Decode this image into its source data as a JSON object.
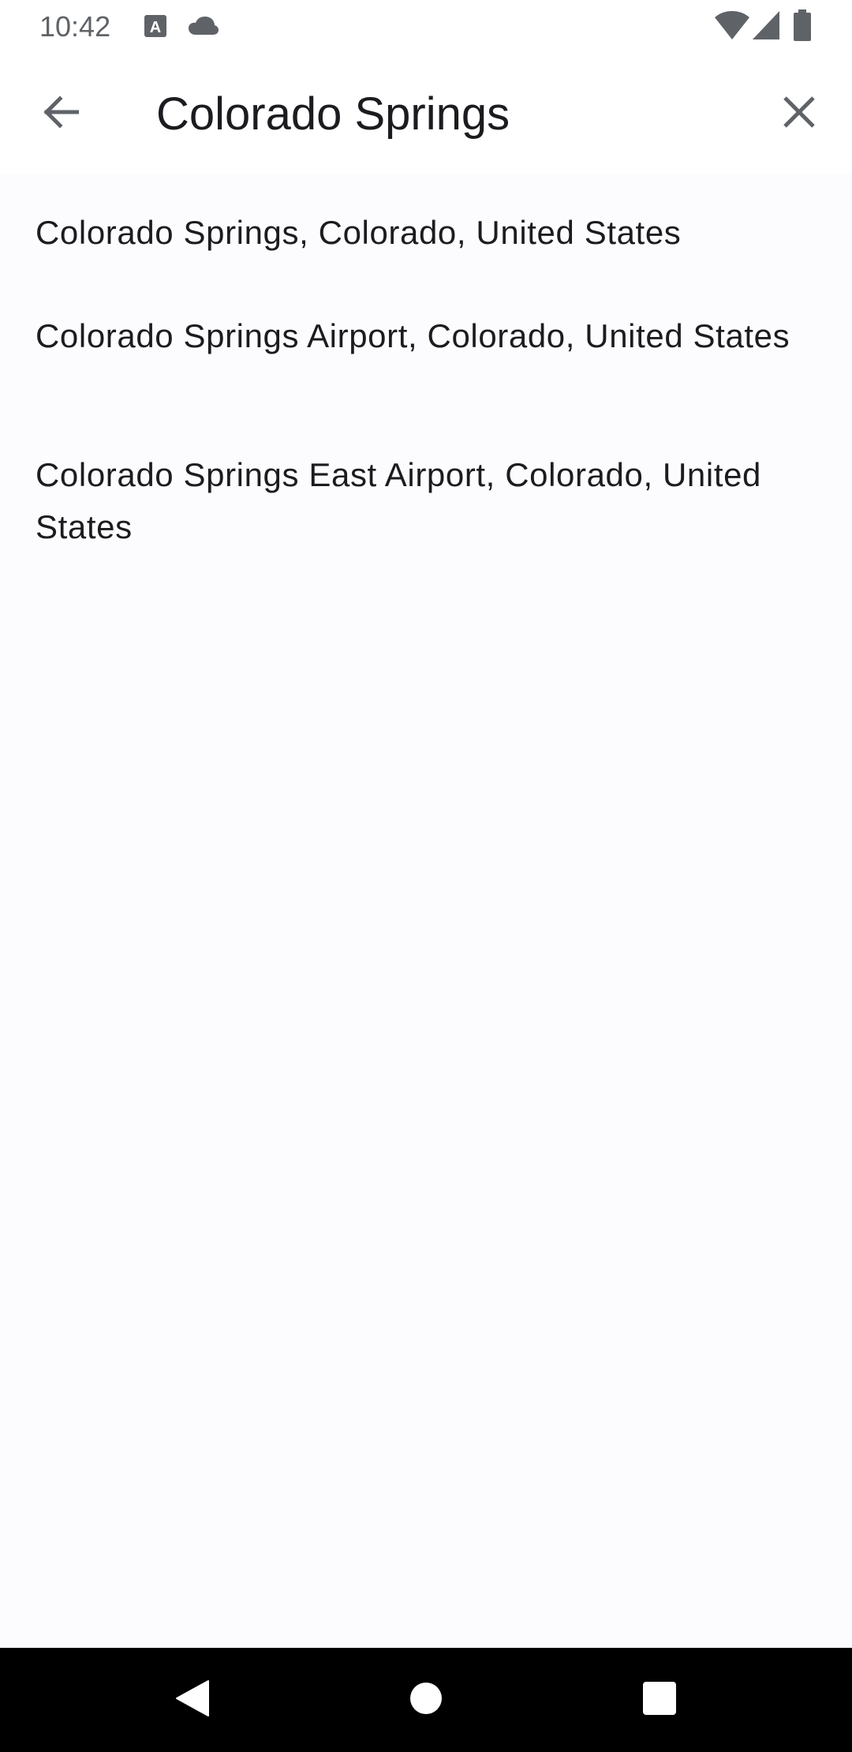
{
  "status_bar": {
    "time": "10:42",
    "icons": [
      "font-a-icon",
      "cloud-icon",
      "wifi-icon",
      "signal-icon",
      "battery-icon"
    ]
  },
  "search": {
    "value": "Colorado Springs",
    "back_icon": "arrow-left-icon",
    "clear_icon": "close-icon"
  },
  "results": [
    "Colorado Springs, Colorado, United States",
    "Colorado Springs Airport, Colorado, United States",
    "Colorado Springs East Airport, Colorado, United States"
  ],
  "nav_bar": {
    "icons": [
      "back-triangle-icon",
      "home-circle-icon",
      "recents-square-icon"
    ]
  },
  "colors": {
    "background": "#fcfcff",
    "text": "#1c1b1f",
    "icon": "#5f6368",
    "nav_bar": "#000000"
  }
}
